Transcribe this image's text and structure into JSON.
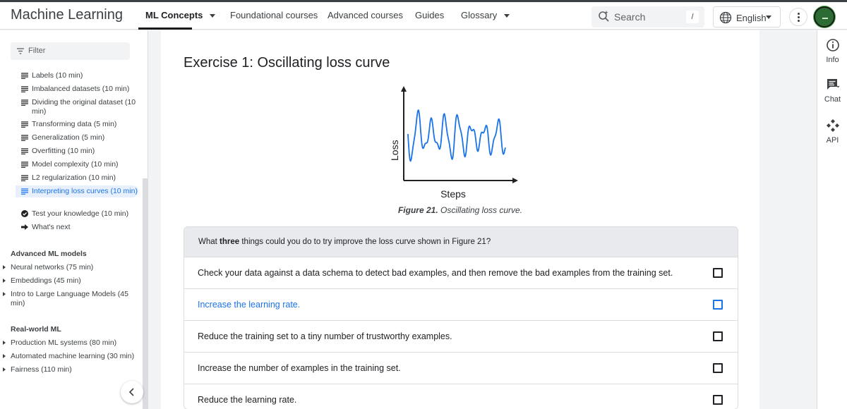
{
  "header": {
    "brand": "Machine Learning",
    "nav": [
      {
        "label": "ML Concepts",
        "active": true,
        "has_caret": true
      },
      {
        "label": "Foundational courses"
      },
      {
        "label": "Advanced courses"
      },
      {
        "label": "Guides"
      },
      {
        "label": "Glossary",
        "has_caret": true
      }
    ],
    "search_placeholder": "Search",
    "search_shortcut": "/",
    "language": "English"
  },
  "sidebar": {
    "filter_placeholder": "Filter",
    "toc": [
      {
        "label": "Labels (10 min)",
        "icon": "article-icon"
      },
      {
        "label": "Imbalanced datasets (10 min)",
        "icon": "article-icon"
      },
      {
        "label": "Dividing the original dataset (10 min)",
        "icon": "article-icon"
      },
      {
        "label": "Transforming data (5 min)",
        "icon": "article-icon"
      },
      {
        "label": "Generalization (5 min)",
        "icon": "article-icon"
      },
      {
        "label": "Overfitting (10 min)",
        "icon": "article-icon"
      },
      {
        "label": "Model complexity (10 min)",
        "icon": "article-icon"
      },
      {
        "label": "L2 regularization (10 min)",
        "icon": "article-icon"
      },
      {
        "label": "Interpreting loss curves (10 min)",
        "icon": "article-icon",
        "active": true
      },
      {
        "label": "Test your knowledge (10 min)",
        "icon": "check-circle-icon"
      },
      {
        "label": "What's next",
        "icon": "arrow-right-icon"
      }
    ],
    "sections": [
      {
        "title": "Advanced ML models",
        "items": [
          "Neural networks (75 min)",
          "Embeddings (45 min)",
          "Intro to Large Language Models (45 min)"
        ]
      },
      {
        "title": "Real-world ML",
        "items": [
          "Production ML systems (80 min)",
          "Automated machine learning (30 min)",
          "Fairness (110 min)"
        ]
      }
    ]
  },
  "main": {
    "title": "Exercise 1: Oscillating loss curve",
    "figure": {
      "ylabel": "Loss",
      "xlabel": "Steps",
      "line_color": "#1a73e8"
    },
    "caption_num": "Figure 21.",
    "caption_text": " Oscillating loss curve.",
    "question": {
      "pre": "What ",
      "bold": "three",
      "post": " things could you do to try improve the loss curve shown in Figure 21?"
    },
    "options": [
      {
        "text": "Check your data against a data schema to detect bad examples, and then remove the bad examples from the training set.",
        "checked": false
      },
      {
        "text": "Increase the learning rate.",
        "checked": false,
        "highlighted": true
      },
      {
        "text": "Reduce the training set to a tiny number of trustworthy examples.",
        "checked": false
      },
      {
        "text": "Increase the number of examples in the training set.",
        "checked": false
      },
      {
        "text": "Reduce the learning rate.",
        "checked": false
      }
    ]
  },
  "rail": {
    "items": [
      {
        "label": "Info",
        "icon": "info-icon"
      },
      {
        "label": "Chat",
        "icon": "chat-icon"
      },
      {
        "label": "API",
        "icon": "api-icon"
      }
    ]
  },
  "colors": {
    "accent": "#1a73e8",
    "active_bg": "#e8f0fe"
  }
}
